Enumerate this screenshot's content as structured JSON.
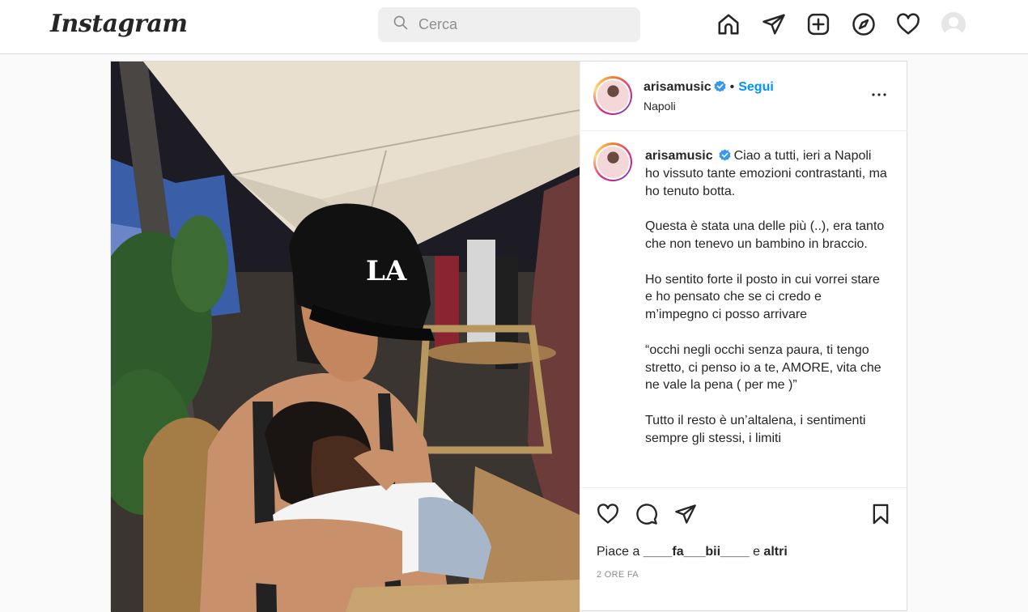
{
  "nav": {
    "logo": "Instagram",
    "search_placeholder": "Cerca",
    "icons": [
      "home-icon",
      "direct-icon",
      "new-post-icon",
      "explore-icon",
      "activity-icon",
      "profile-avatar"
    ]
  },
  "post": {
    "author": {
      "username": "arisamusic",
      "verified": true,
      "location": "Napoli",
      "follow_label": "Segui",
      "separator": "•"
    },
    "caption": {
      "username": "arisamusic",
      "paragraphs": [
        "Ciao a tutti, ieri a Napoli ho vissuto tante emozioni contrastanti, ma ho tenuto botta.",
        "Questa è stata una delle più (..), era tanto che non tenevo un bambino in braccio.",
        "Ho sentito forte il posto in cui vorrei stare e ho pensato che se ci credo e m’impegno ci posso arrivare",
        "“occhi negli occhi senza paura, ti tengo stretto, ci penso io a te, AMORE, vita che ne vale la pena ( per me )”",
        "Tutto il resto è un’altalena, i sentimenti sempre gli stessi, i limiti"
      ]
    },
    "likes": {
      "prefix": "Piace a",
      "user": "____fa___bii____",
      "connector": "e",
      "others": "altri"
    },
    "time": "2 ORE FA"
  },
  "colors": {
    "accent": "#0095f6",
    "verified": "#3897f0",
    "border": "#dbdbdb",
    "background": "#fafafa"
  }
}
